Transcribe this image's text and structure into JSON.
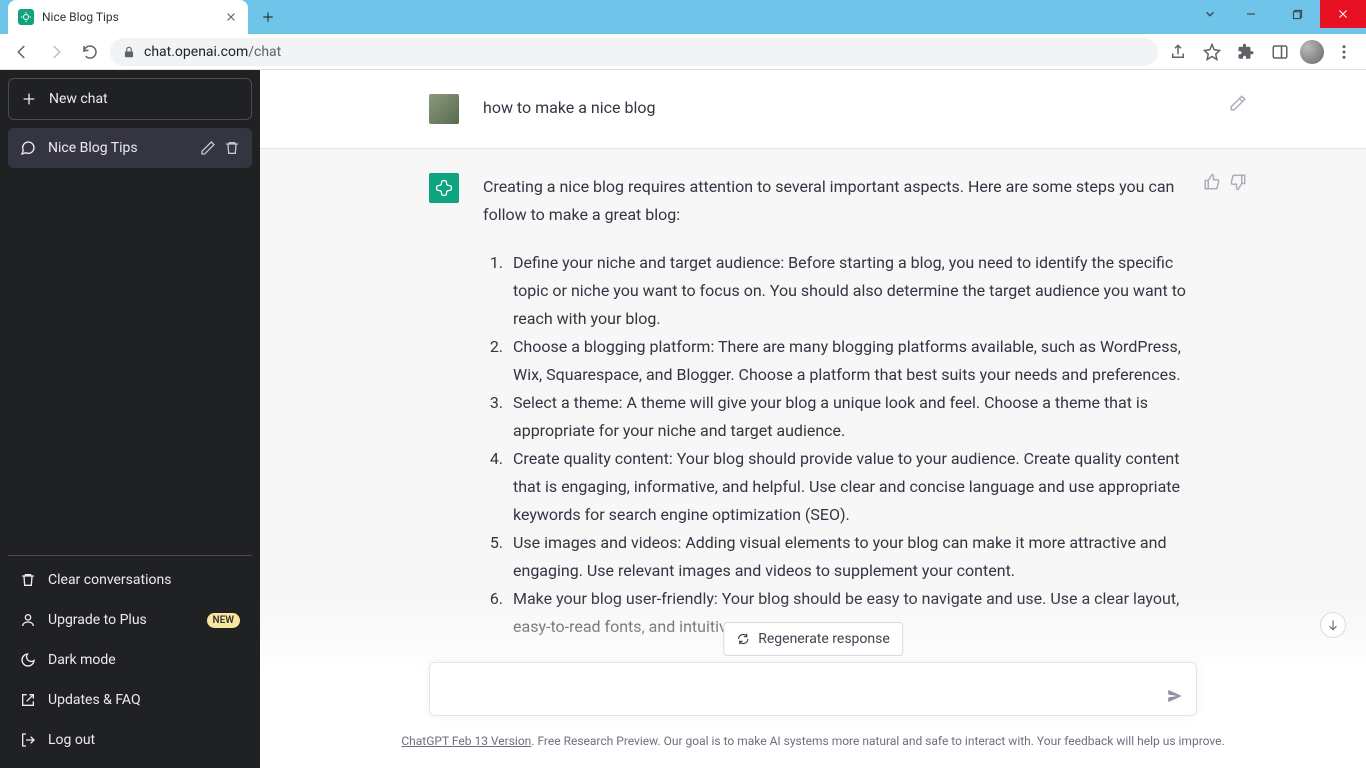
{
  "browser": {
    "tab_title": "Nice Blog Tips",
    "url_domain": "chat.openai.com",
    "url_path": "/chat"
  },
  "sidebar": {
    "new_chat": "New chat",
    "conversations": [
      {
        "title": "Nice Blog Tips"
      }
    ],
    "footer": {
      "clear": "Clear conversations",
      "upgrade": "Upgrade to Plus",
      "upgrade_badge": "NEW",
      "dark_mode": "Dark mode",
      "updates": "Updates & FAQ",
      "logout": "Log out"
    }
  },
  "chat": {
    "user_msg": "how to make a nice blog",
    "assistant_intro": "Creating a nice blog requires attention to several important aspects. Here are some steps you can follow to make a great blog:",
    "assistant_steps": [
      "Define your niche and target audience: Before starting a blog, you need to identify the specific topic or niche you want to focus on. You should also determine the target audience you want to reach with your blog.",
      "Choose a blogging platform: There are many blogging platforms available, such as WordPress, Wix, Squarespace, and Blogger. Choose a platform that best suits your needs and preferences.",
      "Select a theme: A theme will give your blog a unique look and feel. Choose a theme that is appropriate for your niche and target audience.",
      "Create quality content: Your blog should provide value to your audience. Create quality content that is engaging, informative, and helpful. Use clear and concise language and use appropriate keywords for search engine optimization (SEO).",
      "Use images and videos: Adding visual elements to your blog can make it more attractive and engaging. Use relevant images and videos to supplement your content.",
      "Make your blog user-friendly: Your blog should be easy to navigate and use. Use a clear layout, easy-to-read fonts, and intuitive menus."
    ]
  },
  "controls": {
    "regenerate": "Regenerate response",
    "input_placeholder": ""
  },
  "footer": {
    "version_link": "ChatGPT Feb 13 Version",
    "note": ". Free Research Preview. Our goal is to make AI systems more natural and safe to interact with. Your feedback will help us improve."
  }
}
